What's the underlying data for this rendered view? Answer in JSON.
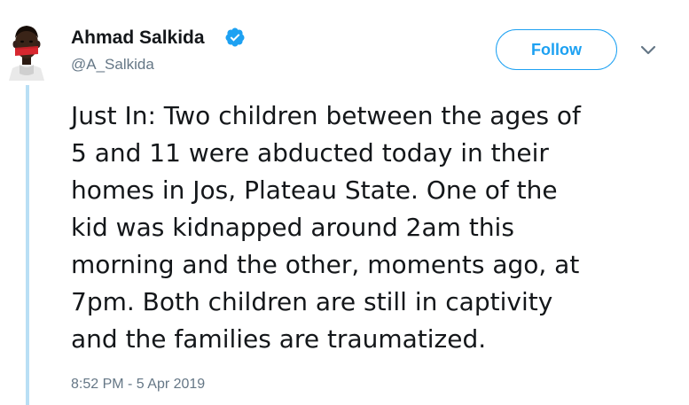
{
  "author": {
    "name": "Ahmad Salkida",
    "handle": "@A_Salkida",
    "verified": true,
    "avatar_icon": "profile-photo-man-with-red-tape-over-mouth"
  },
  "header": {
    "follow_label": "Follow",
    "menu_icon": "chevron-down-icon"
  },
  "tweet": {
    "lines": [
      "Just In: Two children between the ages of",
      "5 and 11 were abducted today in their",
      "homes in Jos, Plateau State. One of the",
      "kid was kidnapped around 2am this",
      "morning and the other, moments ago, at",
      "7pm. Both children are still in captivity",
      "and the families are traumatized."
    ],
    "timestamp": "8:52 PM - 5 Apr 2019"
  },
  "colors": {
    "accent": "#1da1f2",
    "thread_line": "#b9dff5",
    "muted_text": "#657786",
    "primary_text": "#14171a"
  }
}
